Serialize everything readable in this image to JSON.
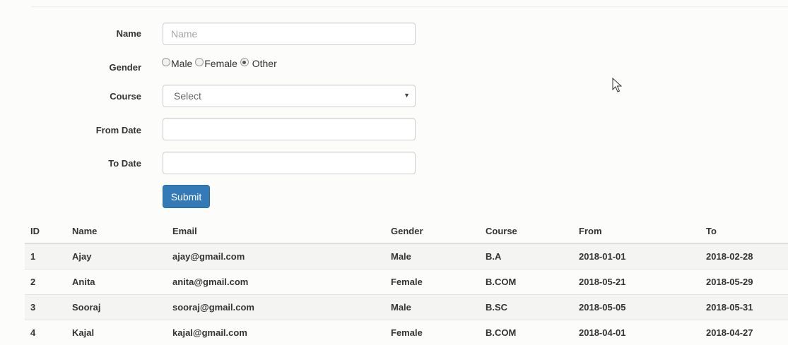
{
  "form": {
    "name_label": "Name",
    "name_placeholder": "Name",
    "name_value": "",
    "gender_label": "Gender",
    "gender_options": [
      "Male",
      "Female",
      "Other"
    ],
    "gender_selected": "Other",
    "course_label": "Course",
    "course_selected": "Select",
    "from_date_label": "From Date",
    "from_date_value": "",
    "to_date_label": "To Date",
    "to_date_value": "",
    "submit_label": "Submit"
  },
  "table": {
    "headers": [
      "ID",
      "Name",
      "Email",
      "Gender",
      "Course",
      "From",
      "To"
    ],
    "rows": [
      [
        "1",
        "Ajay",
        "ajay@gmail.com",
        "Male",
        "B.A",
        "2018-01-01",
        "2018-02-28"
      ],
      [
        "2",
        "Anita",
        "anita@gmail.com",
        "Female",
        "B.COM",
        "2018-05-21",
        "2018-05-29"
      ],
      [
        "3",
        "Sooraj",
        "sooraj@gmail.com",
        "Male",
        "B.SC",
        "2018-05-05",
        "2018-05-31"
      ],
      [
        "4",
        "Kajal",
        "kajal@gmail.com",
        "Female",
        "B.COM",
        "2018-04-01",
        "2018-04-27"
      ]
    ]
  },
  "colors": {
    "primary_button": "#337ab7",
    "striped_row": "#f4f4f3"
  }
}
